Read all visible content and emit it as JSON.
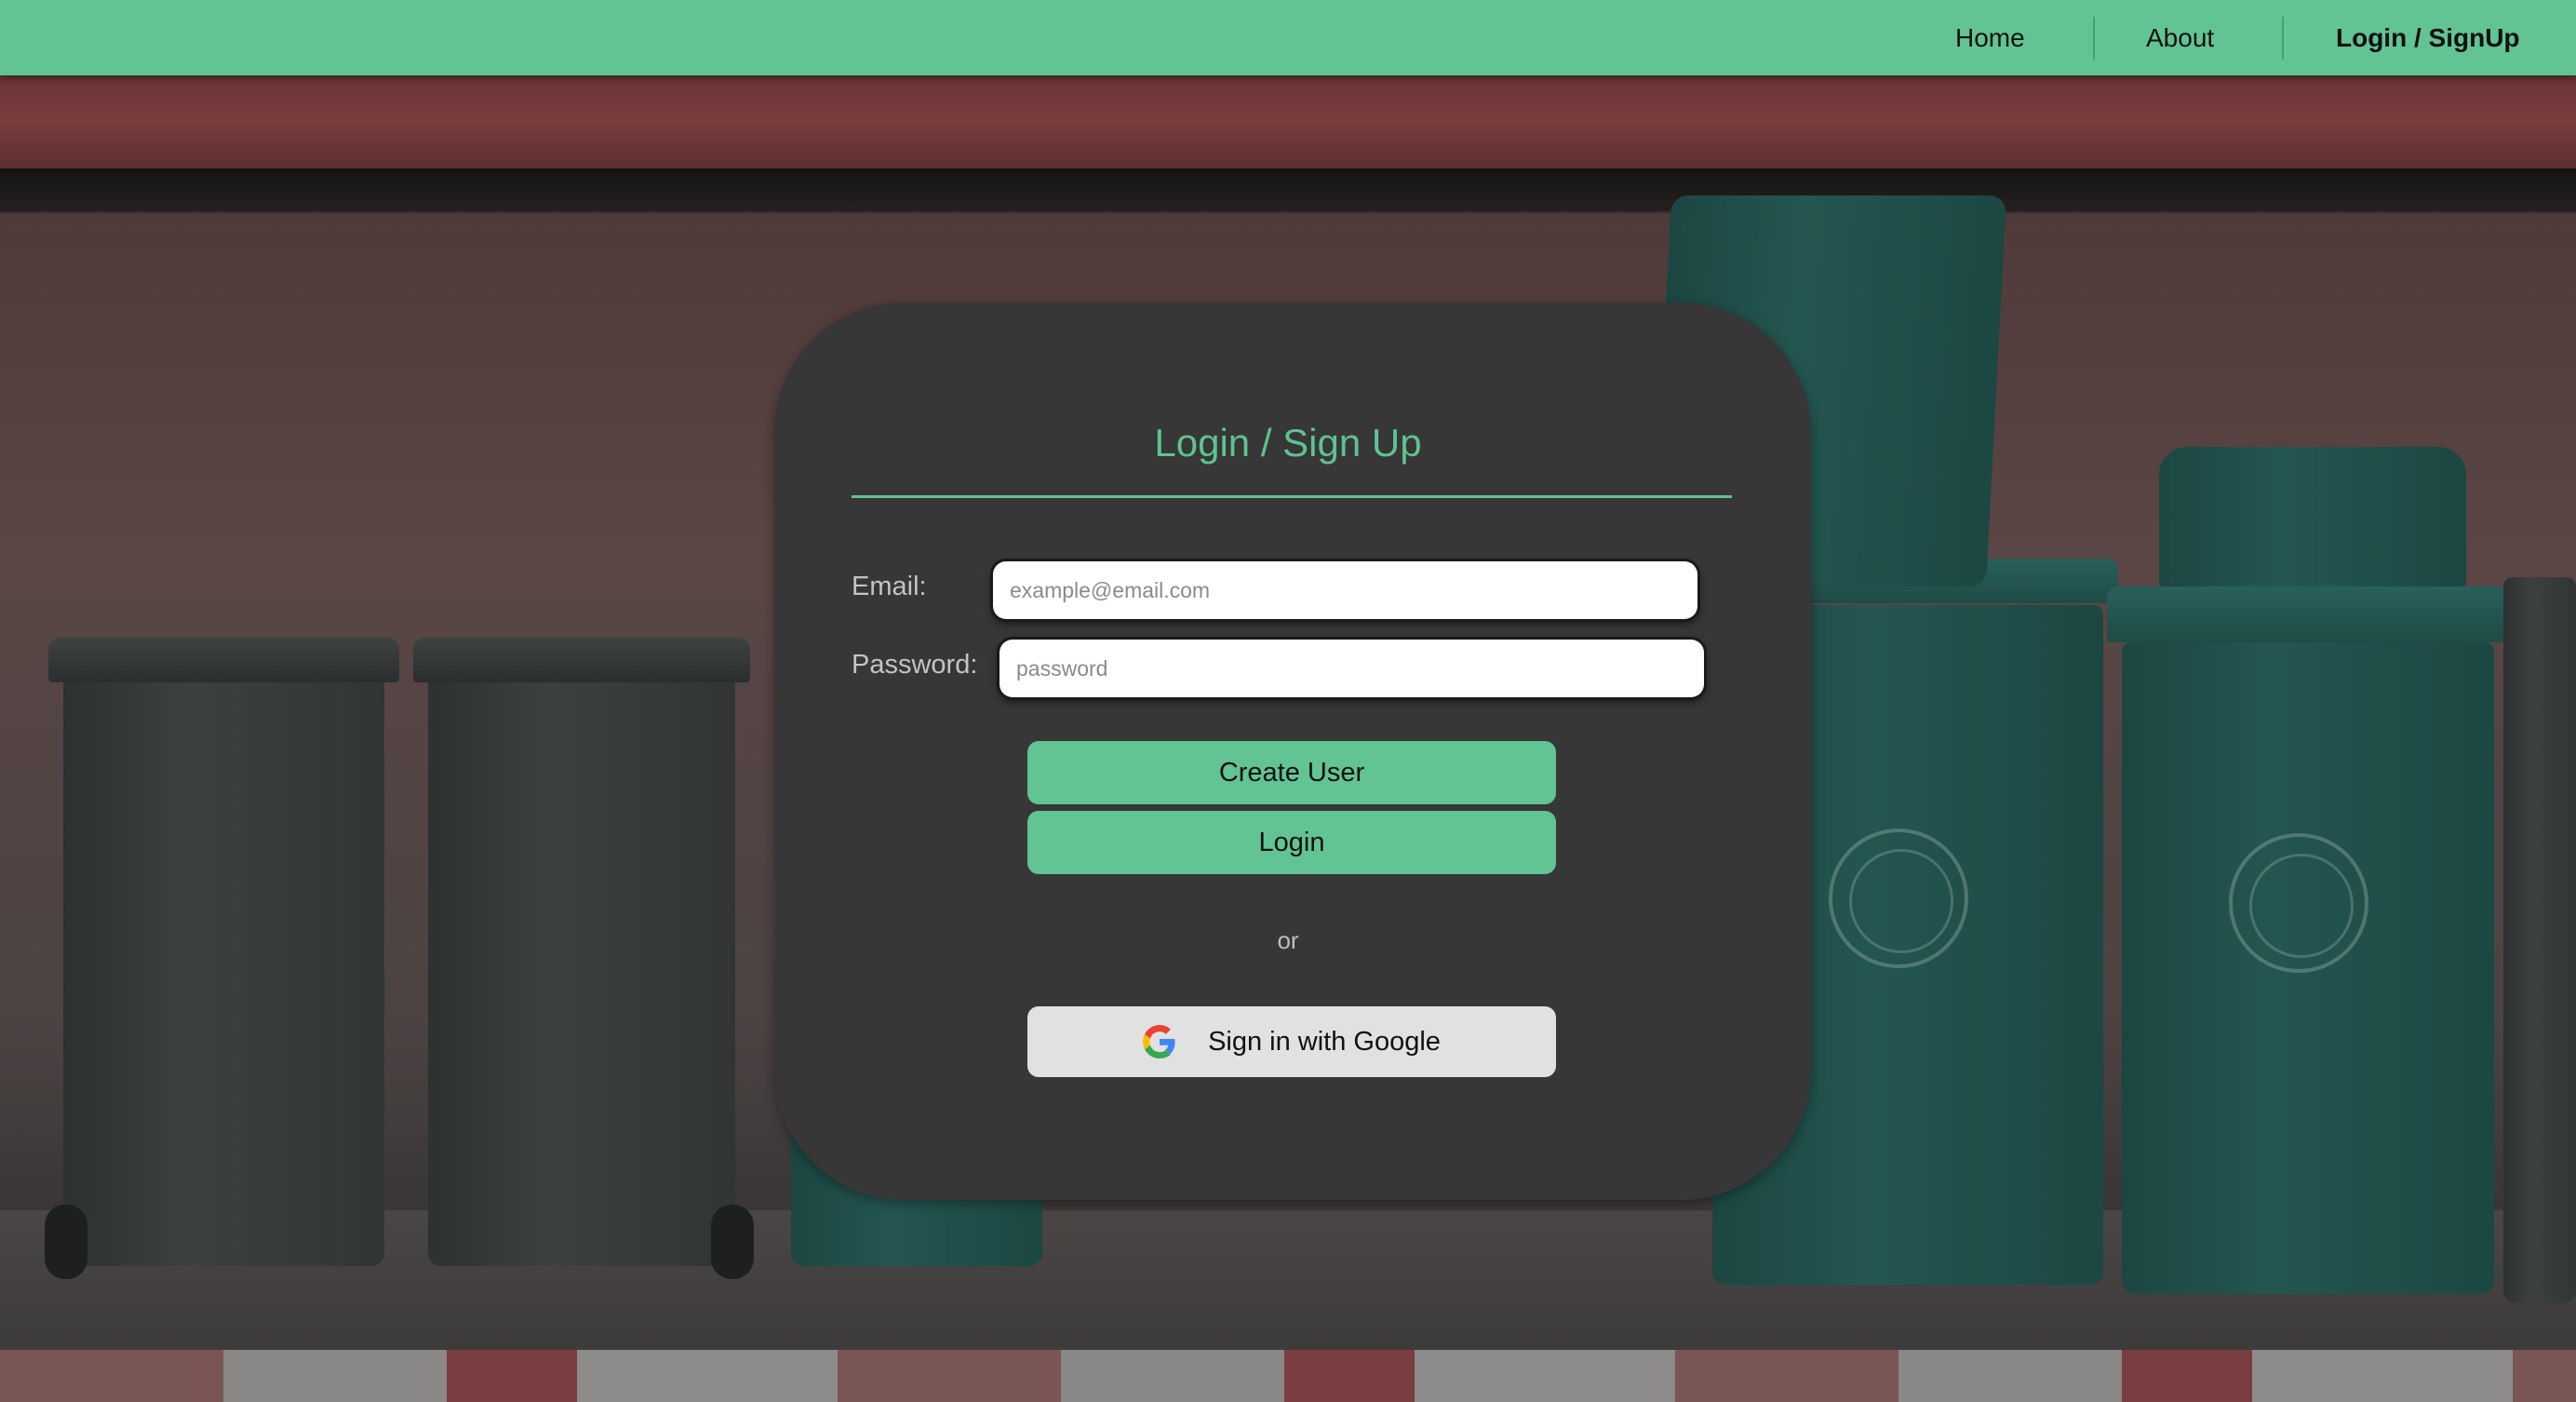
{
  "nav": {
    "items": [
      {
        "label": "Home"
      },
      {
        "label": "About"
      },
      {
        "label": "Login / SignUp",
        "active": true
      }
    ],
    "color": "#62c493"
  },
  "card": {
    "title": "Login / Sign Up",
    "email": {
      "label": "Email:",
      "placeholder": "example@email.com",
      "value": ""
    },
    "password": {
      "label": "Password:",
      "placeholder": "password",
      "value": ""
    },
    "create_user_label": "Create User",
    "login_label": "Login",
    "or_text": "or",
    "google_label": "Sign in with Google",
    "google_icon": "google-g-icon",
    "accent_color": "#5fc291",
    "background_color": "#373737"
  },
  "background": {
    "description_icon": "trash-bins-photo"
  }
}
